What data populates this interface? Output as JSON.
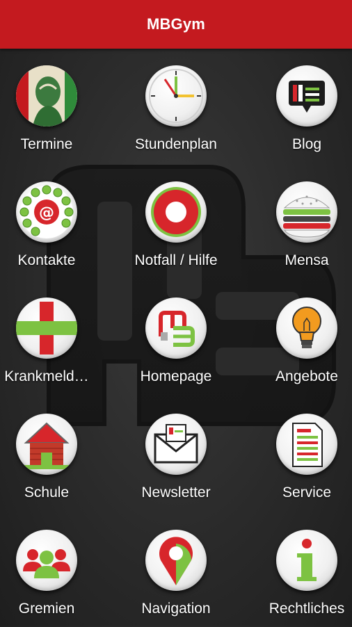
{
  "header": {
    "title": "MBGym"
  },
  "tiles": [
    {
      "label": "Termine",
      "icon": "portrait-calendar-icon"
    },
    {
      "label": "Stundenplan",
      "icon": "clock-icon"
    },
    {
      "label": "Blog",
      "icon": "blog-chat-icon"
    },
    {
      "label": "Kontakte",
      "icon": "rotary-phone-at-icon"
    },
    {
      "label": "Notfall / Hilfe",
      "icon": "lifebuoy-icon"
    },
    {
      "label": "Mensa",
      "icon": "burger-icon"
    },
    {
      "label": "Krankmeld…",
      "icon": "medical-cross-icon"
    },
    {
      "label": "Homepage",
      "icon": "mb-logo-icon"
    },
    {
      "label": "Angebote",
      "icon": "lightbulb-icon"
    },
    {
      "label": "Schule",
      "icon": "school-house-icon"
    },
    {
      "label": "Newsletter",
      "icon": "envelope-icon"
    },
    {
      "label": "Service",
      "icon": "document-icon"
    },
    {
      "label": "Gremien",
      "icon": "group-people-icon"
    },
    {
      "label": "Navigation",
      "icon": "map-pin-icon"
    },
    {
      "label": "Rechtliches",
      "icon": "info-icon"
    }
  ],
  "colors": {
    "header": "#c41a1f",
    "accent_green": "#7dc242",
    "accent_red": "#d7262b"
  }
}
